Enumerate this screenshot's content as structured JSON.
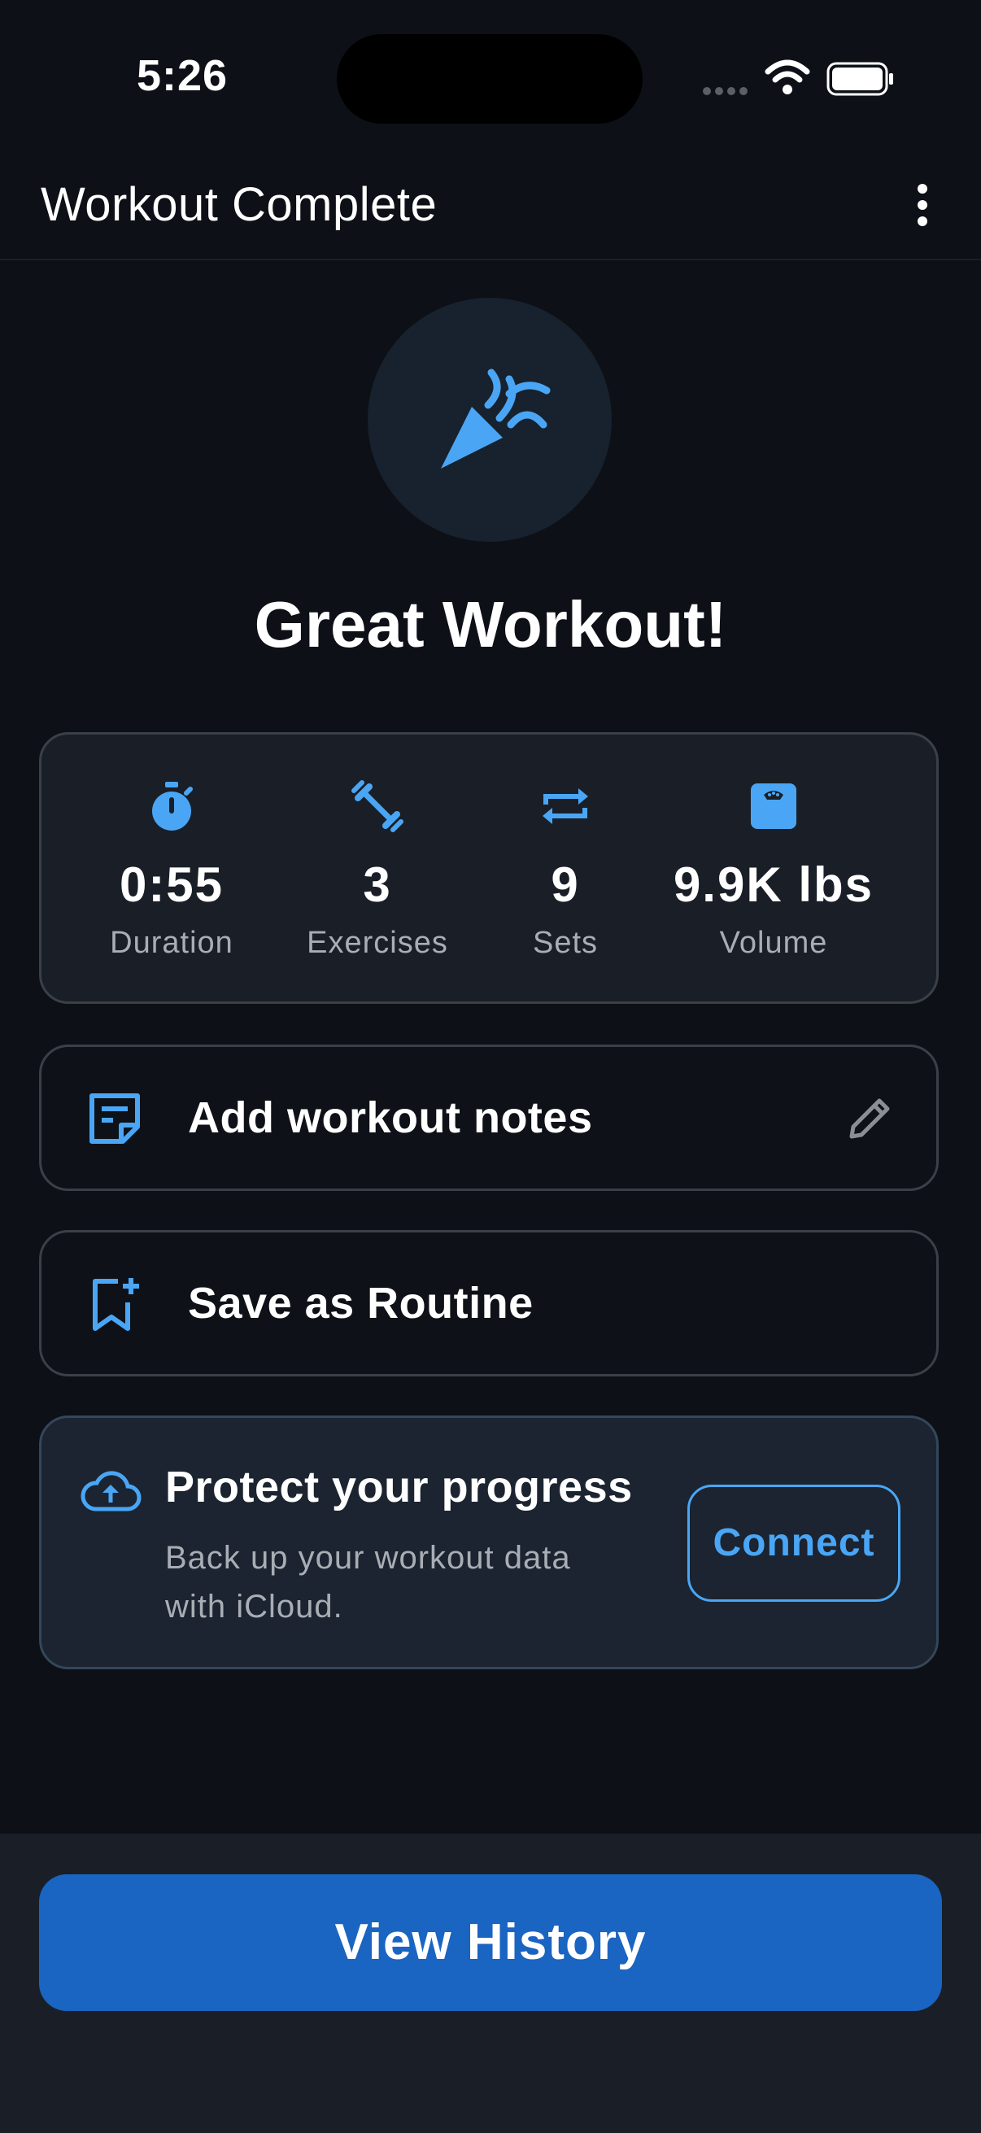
{
  "status_bar": {
    "time": "5:26"
  },
  "header": {
    "title": "Workout Complete"
  },
  "hero": {
    "title": "Great Workout!"
  },
  "stats": [
    {
      "value": "0:55",
      "label": "Duration",
      "icon": "stopwatch-icon"
    },
    {
      "value": "3",
      "label": "Exercises",
      "icon": "dumbbell-icon"
    },
    {
      "value": "9",
      "label": "Sets",
      "icon": "repeat-icon"
    },
    {
      "value": "9.9K lbs",
      "label": "Volume",
      "icon": "weight-scale-icon"
    }
  ],
  "actions": {
    "notes_label": "Add workout notes",
    "routine_label": "Save as Routine"
  },
  "backup": {
    "title": "Protect your progress",
    "text": "Back up your workout data with iCloud.",
    "button": "Connect"
  },
  "footer": {
    "button": "View History"
  },
  "colors": {
    "accent": "#4aa6f5",
    "primary_button": "#1a64c2",
    "background": "#0d1016",
    "card": "#1a1f27"
  }
}
